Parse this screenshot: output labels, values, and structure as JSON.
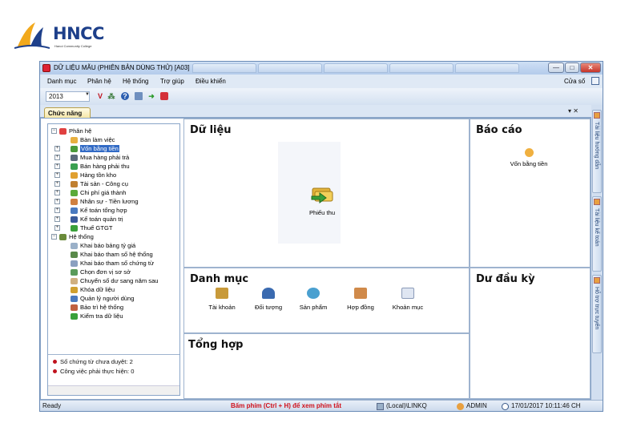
{
  "logo": {
    "name": "HNCC",
    "tagline": "Hanoi Community College",
    "color": "#1d3f8a"
  },
  "window": {
    "title": "DỮ LIỆU MẪU (PHIÊN BẢN DÙNG THỬ) [A03]",
    "controls": {
      "minimize": "—",
      "maximize": "□",
      "close": "✕"
    }
  },
  "menu": {
    "items": [
      "Danh mục",
      "Phân hệ",
      "Hệ thống",
      "Trợ giúp",
      "Điều khiển"
    ],
    "right": "Cửa sổ"
  },
  "toolbar": {
    "year": "2013",
    "icons": [
      "v-icon",
      "tree-icon",
      "help-icon",
      "calc-icon",
      "export-icon",
      "exit-icon"
    ]
  },
  "tab": {
    "label": "Chức năng",
    "controls": "▾ ✕"
  },
  "tree": {
    "root1": "Phân hệ",
    "modules": [
      "Bàn làm việc",
      "Vốn bằng tiền",
      "Mua hàng phải trả",
      "Bán hàng phải thu",
      "Hàng tồn kho",
      "Tài sản - Công cụ",
      "Chi phí giá thành",
      "Nhân sự - Tiền lương",
      "Kế toán tổng hợp",
      "Kế toán quản trị",
      "Thuế GTGT"
    ],
    "root2": "Hệ thống",
    "system": [
      "Khai báo bảng tỷ giá",
      "Khai báo tham số hệ thống",
      "Khai báo tham số chứng từ",
      "Chọn đơn vị sơ sở",
      "Chuyển số dư sang năm sau",
      "Khóa dữ liệu",
      "Quản lý người dùng",
      "Bảo trì hệ thống",
      "Kiểm tra dữ liệu"
    ]
  },
  "pending": {
    "docs": "Số chứng từ chưa duyệt: 2",
    "jobs": "Công việc phải thực hiện: 0"
  },
  "sections": {
    "du_lieu": {
      "title": "Dữ liệu",
      "items": [
        "Phiếu thu"
      ]
    },
    "bao_cao": {
      "title": "Báo cáo",
      "items": [
        "Vốn bằng tiền"
      ]
    },
    "danh_muc": {
      "title": "Danh mục",
      "items": [
        "Tài khoản",
        "Đối tượng",
        "Sản phẩm",
        "Hợp đồng",
        "Khoản mục"
      ]
    },
    "du_dau_ky": {
      "title": "Dư đầu kỳ"
    },
    "tong_hop": {
      "title": "Tổng hợp"
    }
  },
  "dock": [
    "Tài liệu hướng dẫn",
    "Tài liệu kế toán",
    "Hỗ trợ trực tuyến"
  ],
  "status": {
    "left": "Ready",
    "hint": "Bấm phím (Ctrl + H) để xem phím tắt",
    "server": "(Local)\\LINKQ",
    "user": "ADMIN",
    "datetime": "17/01/2017 10:11:46 CH",
    "hint_color": "#d0101a"
  }
}
